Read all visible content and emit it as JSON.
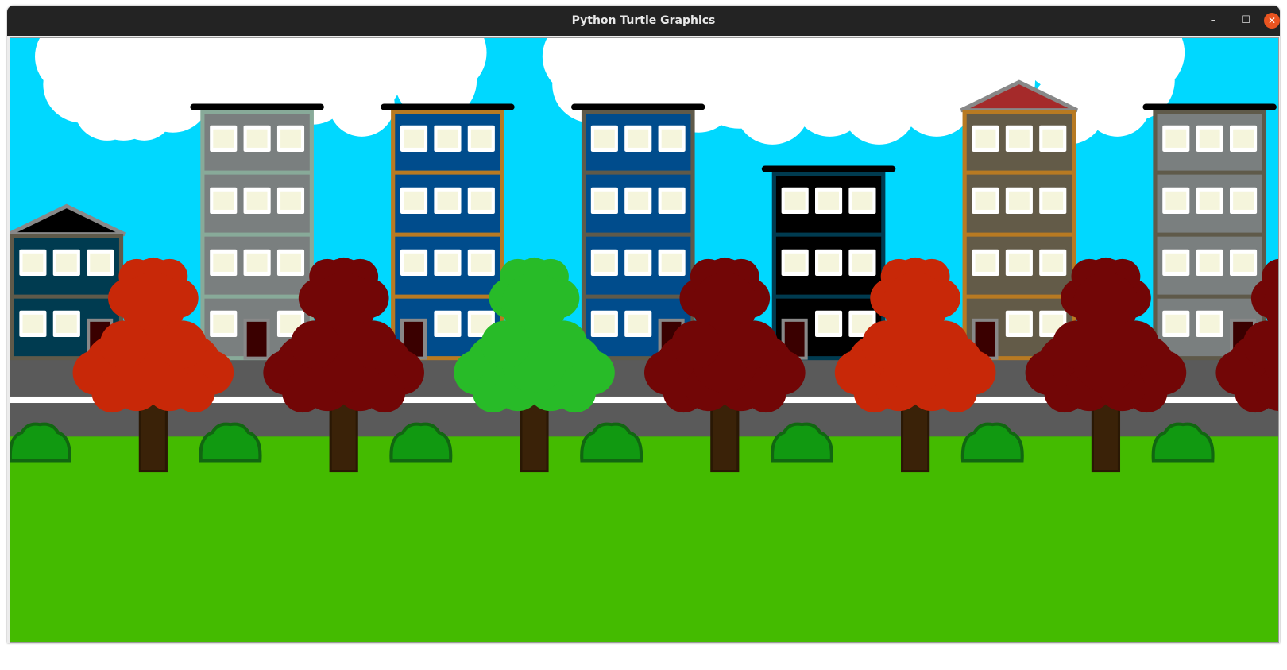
{
  "window": {
    "title": "Python Turtle Graphics",
    "controls": [
      {
        "name": "minimize",
        "glyph": "–"
      },
      {
        "name": "maximize",
        "glyph": "☐"
      },
      {
        "name": "close",
        "glyph": "✕"
      }
    ]
  },
  "scene": {
    "colors": {
      "sky": "#00d8ff",
      "cloud": "#ffffff",
      "grass": "#44bb00",
      "road": "#5a5a5a",
      "road_line": "#ffffff",
      "bush": "#119911",
      "bush_outline": "#116611",
      "trunk": "#3a2208",
      "trunk_outline": "#2a1804",
      "window_frame": "#ffffff",
      "window_glass": "#f5f5dc",
      "door": "#3a0000",
      "door_frame": "#888888",
      "roof_bar": "#000000"
    },
    "buildings": [
      {
        "body": "#003b50",
        "outline": "#5f5a4a",
        "roof": "gable",
        "roof_fill": "#000000",
        "floors": 2,
        "door_column": 3
      },
      {
        "body": "#7a7f7f",
        "outline": "#88aa99",
        "roof": "flat",
        "floors": 4,
        "door_column": 2
      },
      {
        "body": "#004c8c",
        "outline": "#b87a22",
        "roof": "flat",
        "floors": 4,
        "door_column": 1
      },
      {
        "body": "#004c8c",
        "outline": "#5f5a4a",
        "roof": "flat",
        "floors": 4,
        "door_column": 3
      },
      {
        "body": "#000000",
        "outline": "#003b50",
        "roof": "flat",
        "floors": 3,
        "door_column": 1
      },
      {
        "body": "#635b48",
        "outline": "#b87a22",
        "roof": "gable",
        "roof_fill": "#a52a2a",
        "floors": 4,
        "door_column": 1
      },
      {
        "body": "#7a7f7f",
        "outline": "#5f5a4a",
        "roof": "flat",
        "floors": 4,
        "door_column": 3
      }
    ],
    "trees": [
      "#c82808",
      "#720606",
      "#28bb28",
      "#720606",
      "#c82808",
      "#720606",
      "#720606"
    ],
    "bush_count": 7
  }
}
